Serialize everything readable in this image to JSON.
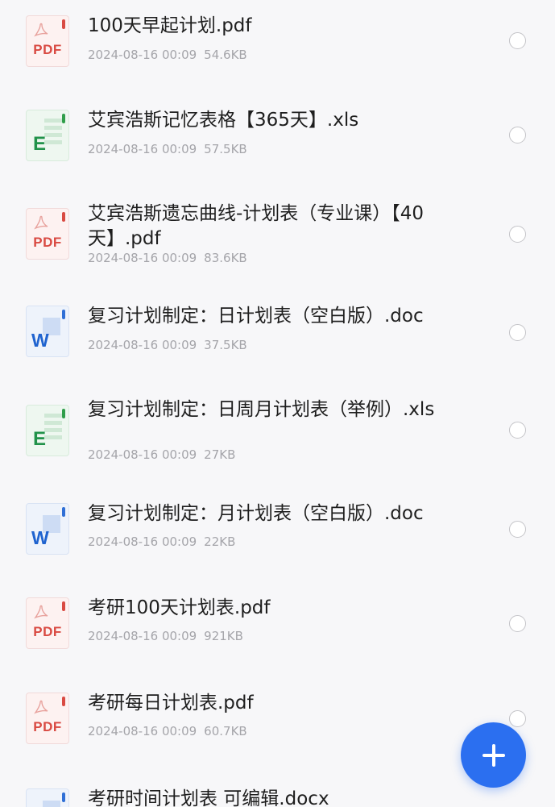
{
  "files": [
    {
      "name": "100天早起计划.pdf",
      "date": "2024-08-16 00:09",
      "size": "54.6KB",
      "type": "pdf",
      "type_label": "PDF"
    },
    {
      "name": "艾宾浩斯记忆表格【365天】.xls",
      "date": "2024-08-16 00:09",
      "size": "57.5KB",
      "type": "xls",
      "type_label": "E"
    },
    {
      "name": "艾宾浩斯遗忘曲线-计划表（专业课）【40天】.pdf",
      "date": "2024-08-16 00:09",
      "size": "83.6KB",
      "type": "pdf",
      "type_label": "PDF"
    },
    {
      "name": "复习计划制定：日计划表（空白版）.doc",
      "date": "2024-08-16 00:09",
      "size": "37.5KB",
      "type": "doc",
      "type_label": "W"
    },
    {
      "name": "复习计划制定：日周月计划表（举例）.xls",
      "date": "2024-08-16 00:09",
      "size": "27KB",
      "type": "xls",
      "type_label": "E"
    },
    {
      "name": "复习计划制定：月计划表（空白版）.doc",
      "date": "2024-08-16 00:09",
      "size": "22KB",
      "type": "doc",
      "type_label": "W"
    },
    {
      "name": "考研100天计划表.pdf",
      "date": "2024-08-16 00:09",
      "size": "921KB",
      "type": "pdf",
      "type_label": "PDF"
    },
    {
      "name": "考研每日计划表.pdf",
      "date": "2024-08-16 00:09",
      "size": "60.7KB",
      "type": "pdf",
      "type_label": "PDF"
    },
    {
      "name": "考研时间计划表 可编辑.docx",
      "date": "",
      "size": "",
      "type": "doc",
      "type_label": "W"
    }
  ],
  "fab_icon": "plus-icon",
  "colors": {
    "accent": "#2b6ff0",
    "pdf": "#d94a42",
    "xls": "#21924a",
    "doc": "#1f63cf"
  }
}
